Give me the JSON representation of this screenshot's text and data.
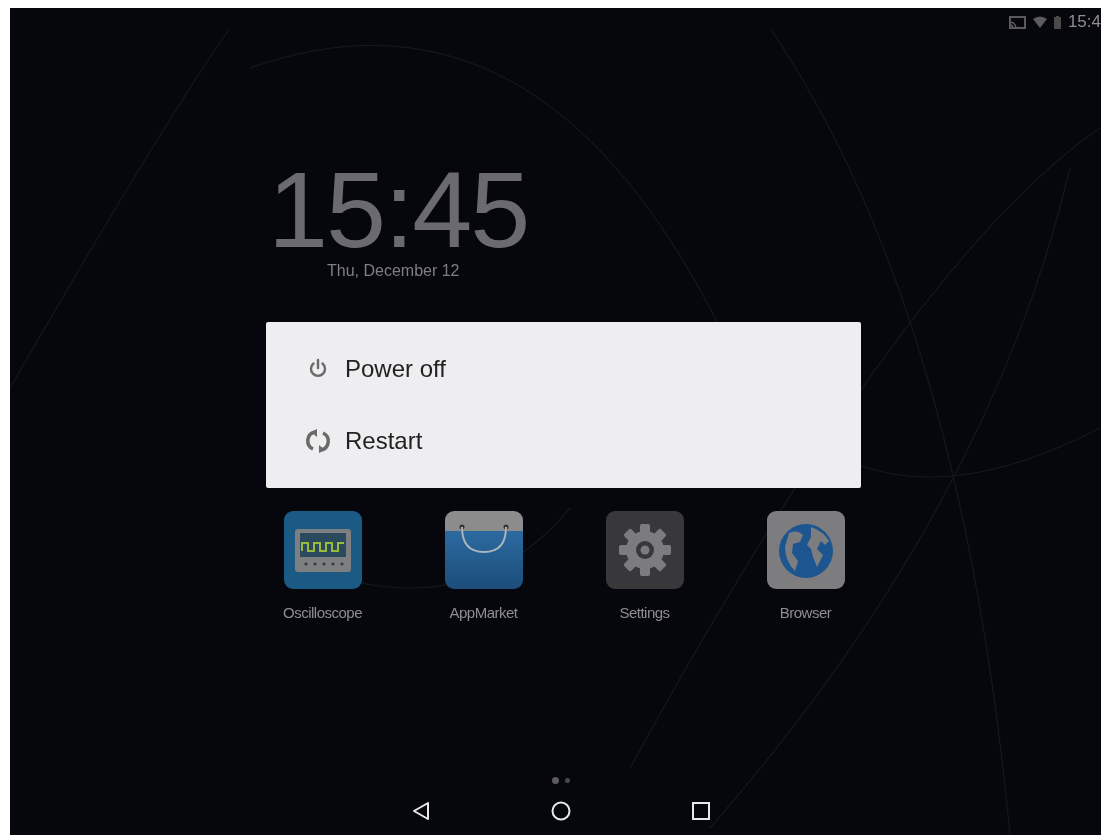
{
  "status_bar": {
    "time": "15:4"
  },
  "clock": {
    "time": "15:45",
    "date": "Thu, December 12"
  },
  "power_menu": {
    "items": [
      {
        "kind": "power",
        "label": "Power off"
      },
      {
        "kind": "restart",
        "label": "Restart"
      }
    ]
  },
  "apps": [
    {
      "kind": "oscilloscope",
      "label": "Oscilloscope"
    },
    {
      "kind": "market",
      "label": "AppMarket"
    },
    {
      "kind": "settings",
      "label": "Settings"
    },
    {
      "kind": "browser",
      "label": "Browser"
    }
  ],
  "page_indicator": [
    {
      "selected": true
    },
    {
      "selected": false
    }
  ],
  "nav_bar": {
    "buttons": [
      {
        "kind": "back"
      },
      {
        "kind": "home"
      },
      {
        "kind": "recents"
      }
    ]
  }
}
